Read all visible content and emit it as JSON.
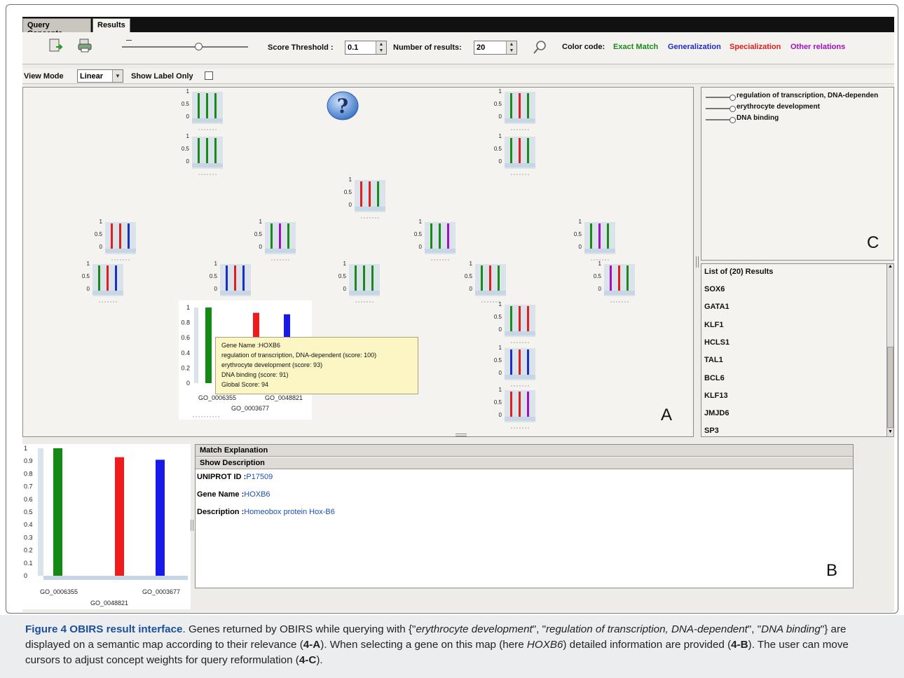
{
  "tabs": [
    {
      "label": "Query Concepts",
      "active": false
    },
    {
      "label": "Results",
      "active": true
    }
  ],
  "toolbar": {
    "score_threshold_label": "Score Threshold :",
    "score_threshold_value": "0.1",
    "results_label": "Number of results:",
    "results_value": "20",
    "color_code_label": "Color code:",
    "legend": [
      {
        "label": "Exact Match",
        "color": "#1a8a1a"
      },
      {
        "label": "Generalization",
        "color": "#1b2fc8"
      },
      {
        "label": "Specialization",
        "color": "#e01e1e"
      },
      {
        "label": "Other relations",
        "color": "#a010c0"
      }
    ]
  },
  "view": {
    "view_mode_label": "View Mode",
    "view_mode_value": "Linear",
    "show_label_only": "Show Label Only"
  },
  "mini_axis": [
    "1",
    "0.5",
    "0"
  ],
  "concepts": [
    {
      "label": "regulation of transcription, DNA-dependen"
    },
    {
      "label": "erythrocyte development"
    },
    {
      "label": "DNA binding"
    }
  ],
  "panel_labels": {
    "a": "A",
    "b": "B",
    "c": "C"
  },
  "results": {
    "header": "List of (20) Results",
    "items": [
      "SOX6",
      "GATA1",
      "KLF1",
      "HCLS1",
      "TAL1",
      "BCL6",
      "KLF13",
      "JMJD6",
      "SP3"
    ]
  },
  "tooltip": {
    "lines": [
      "Gene Name :HOXB6",
      "regulation of transcription, DNA-dependent (score: 100)",
      "erythrocyte development (score: 93)",
      "DNA binding (score: 91)",
      "Global Score: 94"
    ]
  },
  "selected_chart": {
    "y_ticks": [
      "1",
      "0.8",
      "0.6",
      "0.4",
      "0.2",
      "0"
    ],
    "x_labels": [
      "GO_0006355",
      "GO_0048821",
      "GO_0003677"
    ]
  },
  "bottom_chart": {
    "y_ticks": [
      "1",
      "0.9",
      "0.8",
      "0.7",
      "0.6",
      "0.5",
      "0.4",
      "0.3",
      "0.2",
      "0.1",
      "0"
    ],
    "x_labels": [
      "GO_0006355",
      "GO_0048821",
      "GO_0003677"
    ]
  },
  "chart_data": {
    "type": "bar",
    "categories": [
      "GO_0006355",
      "GO_0048821",
      "GO_0003677"
    ],
    "values": [
      1.0,
      0.93,
      0.91
    ],
    "colors": [
      "#138a13",
      "#ee1c1c",
      "#1a1ae8"
    ],
    "ylim": [
      0,
      1
    ]
  },
  "details": {
    "match_explanation": "Match Explanation",
    "show_description": "Show Description",
    "uniprot_label": "UNIPROT ID :",
    "uniprot_value": "P17509",
    "gene_label": "Gene Name :",
    "gene_value": "HOXB6",
    "desc_label": "Description :",
    "desc_value": "Homeobox protein Hox-B6"
  },
  "caption": {
    "title": "Figure 4 OBIRS result interface",
    "text1": ". Genes returned by OBIRS while querying with {\"",
    "q1": "erythrocyte development",
    "sep1": "\", \"",
    "q2": "regulation of transcription, DNA-dependent",
    "sep2": "\", \"",
    "q3": "DNA binding",
    "text2": "\"} are displayed on a semantic map according to their relevance (",
    "ref_a": "4-A",
    "text3": "). When selecting a gene on this map (here ",
    "gene": "HOXB6",
    "text4": ") detailed information are provided (",
    "ref_b": "4-B",
    "text5": "). The user can move cursors to adjust concept weights for query reformulation (",
    "ref_c": "4-C",
    "text6": ")."
  },
  "mini_charts": [
    {
      "bars": [
        "#1a8a1a",
        "#1a8a1a",
        "#1a8a1a"
      ]
    },
    {
      "bars": [
        "#1a8a1a",
        "#e01e1e",
        "#1a8a1a"
      ]
    },
    {
      "bars": [
        "#1a8a1a",
        "#1a8a1a",
        "#1a8a1a"
      ]
    },
    {
      "bars": [
        "#1a8a1a",
        "#e01e1e",
        "#1a8a1a"
      ]
    },
    {
      "bars": [
        "#e01e1e",
        "#e01e1e",
        "#1a8a1a"
      ]
    },
    {
      "bars": [
        "#e01e1e",
        "#e01e1e",
        "#1b2fc8"
      ]
    },
    {
      "bars": [
        "#1a8a1a",
        "#a010c0",
        "#1a8a1a"
      ]
    },
    {
      "bars": [
        "#1a8a1a",
        "#1a8a1a",
        "#a010c0"
      ]
    },
    {
      "bars": [
        "#1a8a1a",
        "#a010c0",
        "#1a8a1a"
      ]
    },
    {
      "bars": [
        "#1a8a1a",
        "#e01e1e",
        "#1b2fc8"
      ]
    },
    {
      "bars": [
        "#1b2fc8",
        "#e01e1e",
        "#1b2fc8"
      ]
    },
    {
      "bars": [
        "#1a8a1a",
        "#1a8a1a",
        "#1a8a1a"
      ]
    },
    {
      "bars": [
        "#1a8a1a",
        "#e01e1e",
        "#1a8a1a"
      ]
    },
    {
      "bars": [
        "#a010c0",
        "#e01e1e",
        "#1a8a1a"
      ]
    },
    {
      "bars": [
        "#1a8a1a",
        "#e01e1e",
        "#e01e1e"
      ]
    },
    {
      "bars": [
        "#1b2fc8",
        "#e01e1e",
        "#1b2fc8"
      ]
    },
    {
      "bars": [
        "#e01e1e",
        "#e01e1e",
        "#a010c0"
      ]
    }
  ]
}
